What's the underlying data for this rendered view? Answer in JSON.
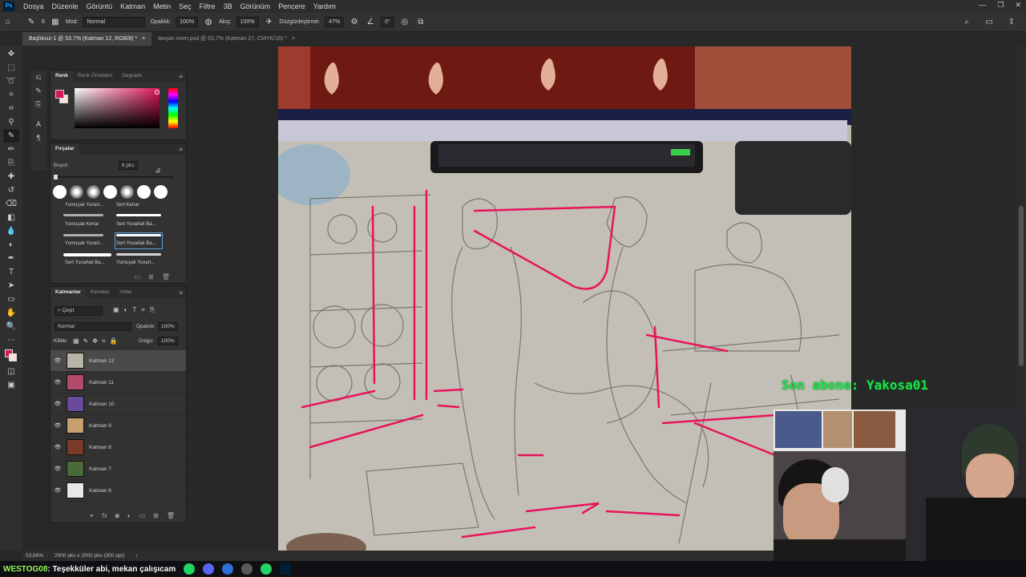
{
  "menu": {
    "app_icon": "Ps",
    "items": [
      "Dosya",
      "Düzenle",
      "Görüntü",
      "Katman",
      "Metin",
      "Seç",
      "Filtre",
      "3B",
      "Görünüm",
      "Pencere",
      "Yardım"
    ]
  },
  "options": {
    "size": "6",
    "mode_label": "Mod:",
    "mode_value": "Normal",
    "opacity_label": "Opaklık:",
    "opacity_value": "100%",
    "flow_label": "Akış:",
    "flow_value": "100%",
    "smoothing_label": "Düzgünleştirme:",
    "smoothing_value": "47%",
    "angle_value": "0°"
  },
  "tabs": [
    {
      "label": "Başlıksız-1 @ 53,7% (Katman 12, RGB/8) *",
      "close": "×"
    },
    {
      "label": "tavşan riven.psd @ 53,7% (Katman 27, CMYK/16) *",
      "close": "×"
    }
  ],
  "color_panel": {
    "tabs": [
      "Renk",
      "Renk Örnekleri",
      "Degrade"
    ]
  },
  "brushes_panel": {
    "title": "Fırçalar",
    "size_label": "Boyut:",
    "size_value": "6 pks",
    "brushes": [
      "Yumuşak Yuvarl...",
      "Sert Kenar",
      "Yumuşak Kenar",
      "Sert Yuvarlak Ba...",
      "Yumuşak Yuvarl...",
      "Sert Yuvarlak Ba...",
      "Sert Yuvarlak Ba...",
      "Yumuşak Yuvarl..."
    ]
  },
  "layers_panel": {
    "tabs": [
      "Katmanlar",
      "Kanallar",
      "Yollar"
    ],
    "filter_label": "Çeşit",
    "blend_mode": "Normal",
    "opacity_label": "Opaklık:",
    "opacity_value": "100%",
    "lock_label": "Kilitle:",
    "fill_label": "Dolgu:",
    "fill_value": "100%",
    "layers": [
      {
        "name": "Katman 12",
        "thumb": "#b9b3a8",
        "selected": true
      },
      {
        "name": "Katman 11",
        "thumb": "#b44a6a"
      },
      {
        "name": "Katman 10",
        "thumb": "#6a4a9a"
      },
      {
        "name": "Katman 9",
        "thumb": "#c8a070"
      },
      {
        "name": "Katman 8",
        "thumb": "#7a3a2a"
      },
      {
        "name": "Katman 7",
        "thumb": "#4a6a3a"
      },
      {
        "name": "Katman 6",
        "thumb": "#e8e8e8"
      }
    ]
  },
  "status": {
    "zoom": "53,68%",
    "doc_size": "2000 pks x 2000 pks (300 ppi)"
  },
  "overlay": {
    "last_sub": "Son abone: Yakosa01"
  },
  "chat": {
    "user": "WESTOG08",
    "message": ": Teşekküler abi, mekan çalışıcam"
  },
  "colors": {
    "foreground": "#d6175a",
    "background": "#f2e3d6",
    "accent_green": "#1fe04a",
    "ink_pink": "#e8135c"
  }
}
